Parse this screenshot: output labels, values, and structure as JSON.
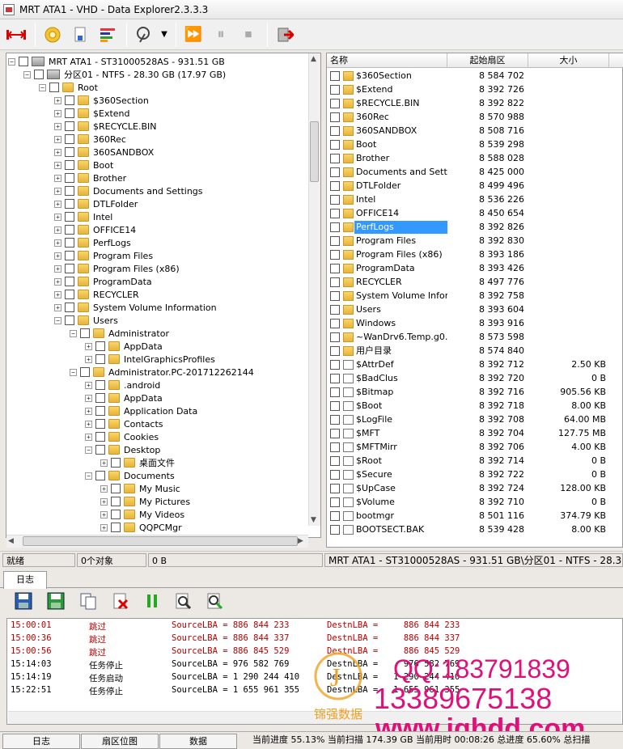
{
  "window": {
    "title": "MRT ATA1 - VHD - Data Explorer2.3.3.3"
  },
  "tree": {
    "disk_label": "MRT ATA1 - ST31000528AS - 931.51 GB",
    "partition_label": "分区01 - NTFS - 28.30 GB (17.97 GB)",
    "root_label": "Root",
    "root_children": [
      "$360Section",
      "$Extend",
      "$RECYCLE.BIN",
      "360Rec",
      "360SANDBOX",
      "Boot",
      "Brother",
      "Documents and Settings",
      "DTLFolder",
      "Intel",
      "OFFICE14",
      "PerfLogs",
      "Program Files",
      "Program Files (x86)",
      "ProgramData",
      "RECYCLER",
      "System Volume Information",
      "Users"
    ],
    "users_children": [
      "Administrator",
      "Administrator.PC-201712262144"
    ],
    "admin_children": [
      "AppData",
      "IntelGraphicsProfiles"
    ],
    "admin_pc_children": [
      ".android",
      "AppData",
      "Application Data",
      "Contacts",
      "Cookies",
      "Desktop"
    ],
    "desktop_children": [
      "桌面文件"
    ],
    "documents_label": "Documents",
    "documents_children": [
      "My Music",
      "My Pictures",
      "My Videos",
      "QQPCMgr"
    ]
  },
  "list": {
    "headers": {
      "name": "名称",
      "sector": "起始扇区",
      "size": "大小"
    },
    "rows": [
      {
        "name": "$360Section",
        "sector": "8 584 702",
        "size": "",
        "type": "folder"
      },
      {
        "name": "$Extend",
        "sector": "8 392 726",
        "size": "",
        "type": "folder"
      },
      {
        "name": "$RECYCLE.BIN",
        "sector": "8 392 822",
        "size": "",
        "type": "folder"
      },
      {
        "name": "360Rec",
        "sector": "8 570 988",
        "size": "",
        "type": "folder"
      },
      {
        "name": "360SANDBOX",
        "sector": "8 508 716",
        "size": "",
        "type": "folder"
      },
      {
        "name": "Boot",
        "sector": "8 539 298",
        "size": "",
        "type": "folder"
      },
      {
        "name": "Brother",
        "sector": "8 588 028",
        "size": "",
        "type": "folder"
      },
      {
        "name": "Documents and Setti...",
        "sector": "8 425 000",
        "size": "",
        "type": "folder"
      },
      {
        "name": "DTLFolder",
        "sector": "8 499 496",
        "size": "",
        "type": "folder"
      },
      {
        "name": "Intel",
        "sector": "8 536 226",
        "size": "",
        "type": "folder"
      },
      {
        "name": "OFFICE14",
        "sector": "8 450 654",
        "size": "",
        "type": "folder"
      },
      {
        "name": "PerfLogs",
        "sector": "8 392 826",
        "size": "",
        "type": "folder",
        "selected": true
      },
      {
        "name": "Program Files",
        "sector": "8 392 830",
        "size": "",
        "type": "folder"
      },
      {
        "name": "Program Files (x86)",
        "sector": "8 393 186",
        "size": "",
        "type": "folder"
      },
      {
        "name": "ProgramData",
        "sector": "8 393 426",
        "size": "",
        "type": "folder"
      },
      {
        "name": "RECYCLER",
        "sector": "8 497 776",
        "size": "",
        "type": "folder"
      },
      {
        "name": "System Volume Infor...",
        "sector": "8 392 758",
        "size": "",
        "type": "folder"
      },
      {
        "name": "Users",
        "sector": "8 393 604",
        "size": "",
        "type": "folder"
      },
      {
        "name": "Windows",
        "sector": "8 393 916",
        "size": "",
        "type": "folder"
      },
      {
        "name": "~WanDrv6.Temp.g0...",
        "sector": "8 573 598",
        "size": "",
        "type": "folder"
      },
      {
        "name": "用户目录",
        "sector": "8 574 840",
        "size": "",
        "type": "folder"
      },
      {
        "name": "$AttrDef",
        "sector": "8 392 712",
        "size": "2.50 KB",
        "type": "file"
      },
      {
        "name": "$BadClus",
        "sector": "8 392 720",
        "size": "0 B",
        "type": "file"
      },
      {
        "name": "$Bitmap",
        "sector": "8 392 716",
        "size": "905.56 KB",
        "type": "file"
      },
      {
        "name": "$Boot",
        "sector": "8 392 718",
        "size": "8.00 KB",
        "type": "file"
      },
      {
        "name": "$LogFile",
        "sector": "8 392 708",
        "size": "64.00 MB",
        "type": "file"
      },
      {
        "name": "$MFT",
        "sector": "8 392 704",
        "size": "127.75 MB",
        "type": "file"
      },
      {
        "name": "$MFTMirr",
        "sector": "8 392 706",
        "size": "4.00 KB",
        "type": "file"
      },
      {
        "name": "$Root",
        "sector": "8 392 714",
        "size": "0 B",
        "type": "file"
      },
      {
        "name": "$Secure",
        "sector": "8 392 722",
        "size": "0 B",
        "type": "file"
      },
      {
        "name": "$UpCase",
        "sector": "8 392 724",
        "size": "128.00 KB",
        "type": "file"
      },
      {
        "name": "$Volume",
        "sector": "8 392 710",
        "size": "0 B",
        "type": "file"
      },
      {
        "name": "bootmgr",
        "sector": "8 501 116",
        "size": "374.79 KB",
        "type": "file"
      },
      {
        "name": "BOOTSECT.BAK",
        "sector": "8 539 428",
        "size": "8.00 KB",
        "type": "file"
      }
    ]
  },
  "status": {
    "state": "就绪",
    "objects": "0个对象",
    "bytes": "0 B",
    "path": "MRT ATA1 - ST31000528AS - 931.51 GB\\分区01 - NTFS - 28.30"
  },
  "log": {
    "tab_label": "日志",
    "entries": [
      {
        "time": "15:00:01",
        "msg": "跳过",
        "src": "SourceLBA = 886 844 233",
        "dst": "DestnLBA =     886 844 233",
        "red": true
      },
      {
        "time": "15:00:36",
        "msg": "跳过",
        "src": "SourceLBA = 886 844 337",
        "dst": "DestnLBA =     886 844 337",
        "red": true
      },
      {
        "time": "15:00:56",
        "msg": "跳过",
        "src": "SourceLBA = 886 845 529",
        "dst": "DestnLBA =     886 845 529",
        "red": true
      },
      {
        "time": "15:14:03",
        "msg": "任务停止",
        "src": "SourceLBA = 976 582 769",
        "dst": "DestnLBA =     976 582 769",
        "red": false
      },
      {
        "time": "15:14:19",
        "msg": "任务启动",
        "src": "SourceLBA = 1 290 244 410",
        "dst": "DestnLBA =   1 290 244 410",
        "red": false
      },
      {
        "time": "15:22:51",
        "msg": "任务停止",
        "src": "SourceLBA = 1 655 961 355",
        "dst": "DestnLBA =   1 655 961 355",
        "red": false
      }
    ]
  },
  "watermark": {
    "qq": "QQ:183791839",
    "phone": "13389675138",
    "url": "www.jqhdd.com",
    "brand": "锦强数据",
    "color": "#e0107a"
  },
  "bottom": {
    "tabs": [
      "日志",
      "扇区位图",
      "数据"
    ],
    "progress": "当前进度 55.13% 当前扫描 174.39 GB 当前用时 00:08:26   总进度 65.60% 总扫描"
  }
}
